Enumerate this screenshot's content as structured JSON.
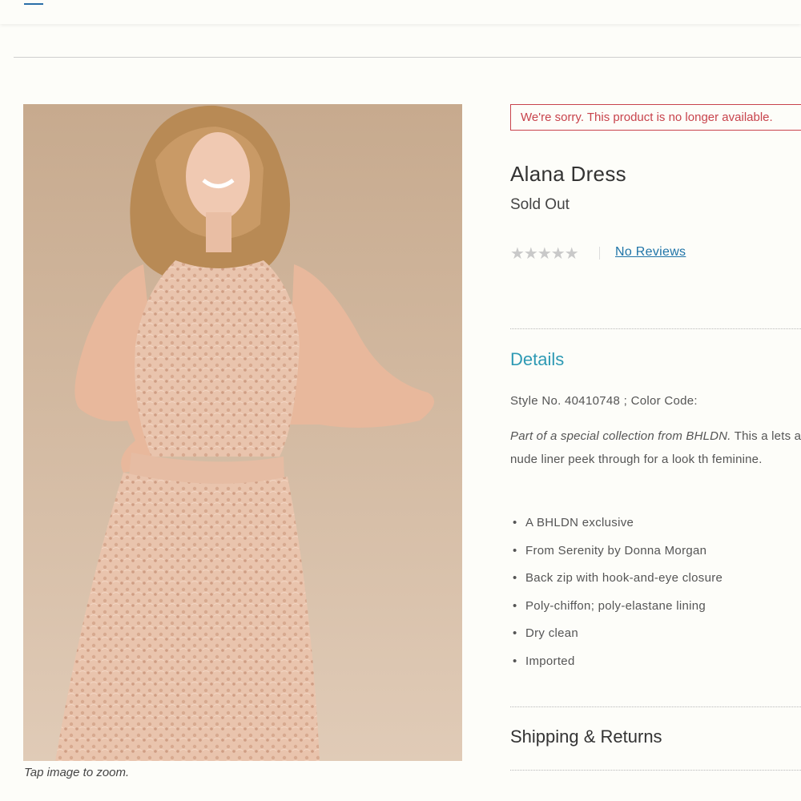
{
  "header": {
    "menu_icon": "hamburger-menu-icon"
  },
  "image": {
    "caption": "Tap image to zoom."
  },
  "notice": {
    "text": "We're sorry. This product is no longer available."
  },
  "product": {
    "title": "Alana Dress",
    "status": "Sold Out",
    "rating": {
      "stars": "★★★★★",
      "value": 0,
      "max": 5,
      "reviews_label": "No Reviews"
    }
  },
  "details": {
    "heading": "Details",
    "style_line": "Style No. 40410748 ; Color Code:",
    "description_em": "Part of a special collection from BHLDN.",
    "description_rest": " This a lets a rosy nude liner peek through for a look th feminine.",
    "bullets": [
      "A BHLDN exclusive",
      "From Serenity by Donna Morgan",
      "Back zip with hook-and-eye closure",
      "Poly-chiffon; poly-elastane lining",
      "Dry clean",
      "Imported"
    ]
  },
  "shipping": {
    "heading": "Shipping & Returns"
  },
  "colors": {
    "accent": "#2e9ab4",
    "link": "#1f74a8",
    "alert": "#c8434c",
    "background": "#fdfdf9"
  }
}
